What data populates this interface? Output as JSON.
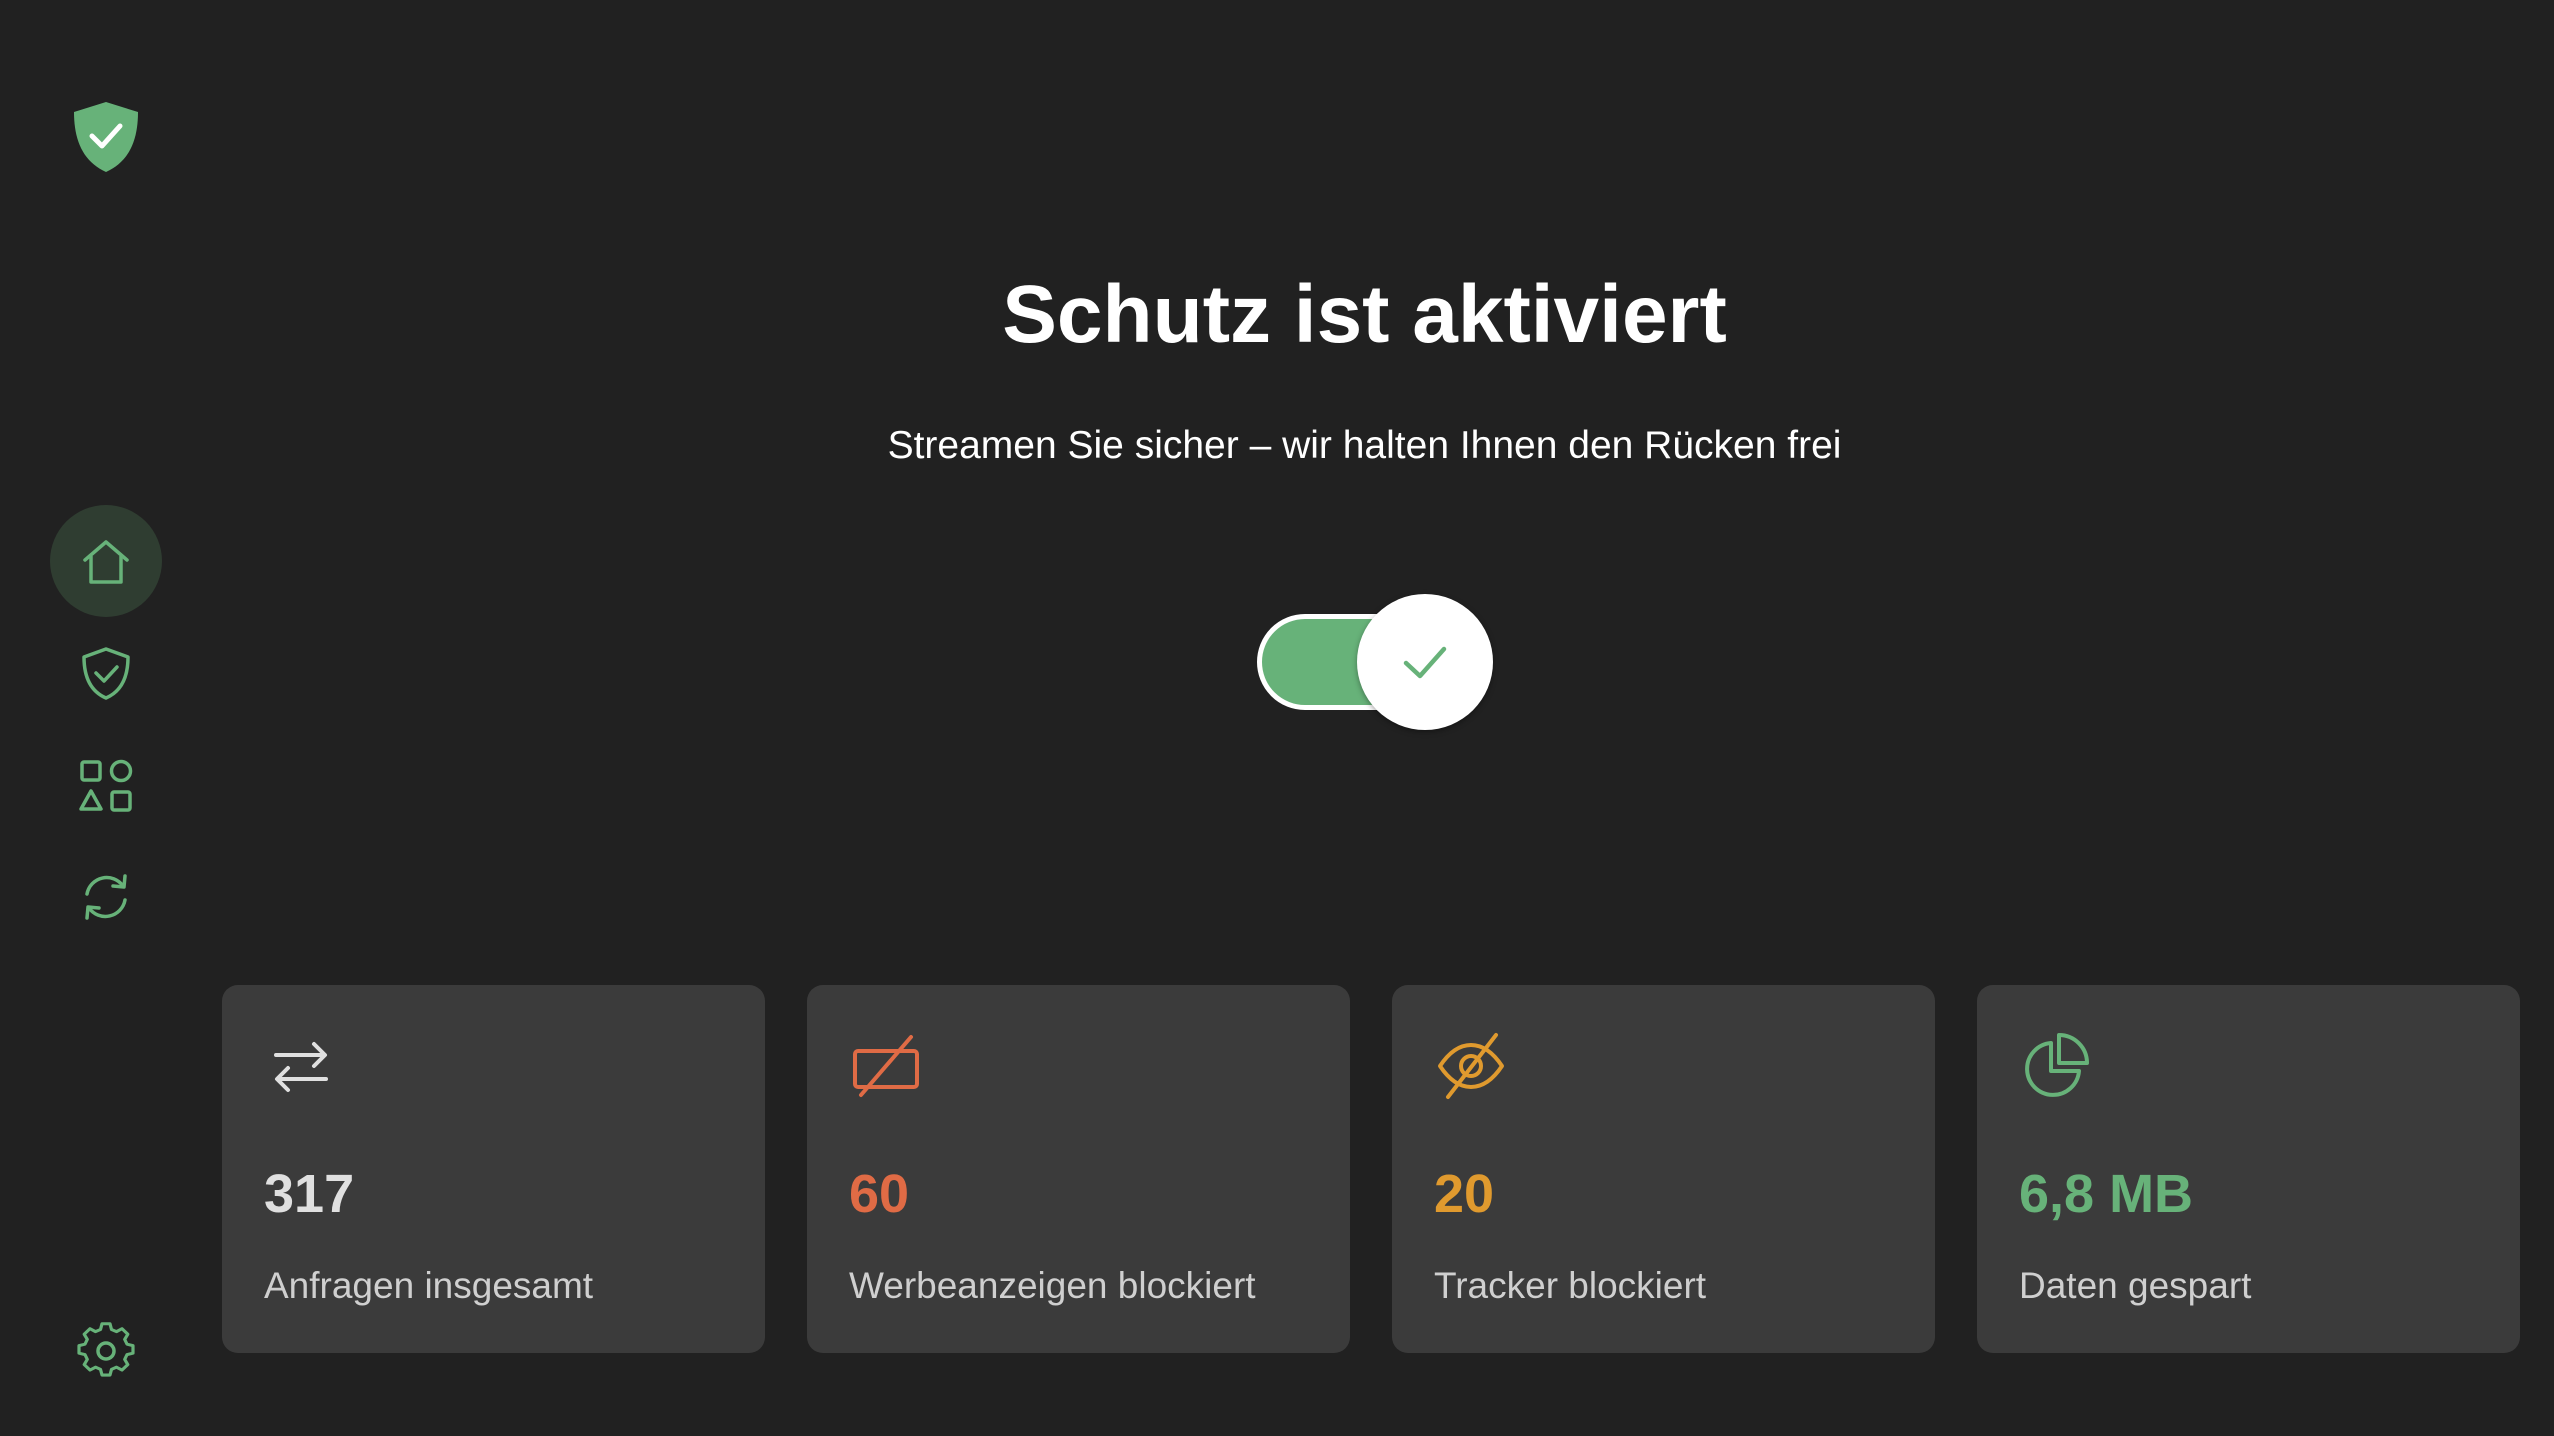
{
  "app": {
    "logo_icon": "shield-check-icon",
    "accent_color": "#67b279"
  },
  "sidebar": {
    "items": [
      {
        "id": "home",
        "icon": "home-icon",
        "active": true
      },
      {
        "id": "protection",
        "icon": "shield-check-icon",
        "active": false
      },
      {
        "id": "apps",
        "icon": "apps-grid-icon",
        "active": false
      },
      {
        "id": "update",
        "icon": "refresh-icon",
        "active": false
      }
    ],
    "settings_icon": "gear-icon"
  },
  "hero": {
    "title": "Schutz ist aktiviert",
    "subtitle": "Streamen Sie sicher – wir halten Ihnen den Rücken frei",
    "toggle_on": true
  },
  "stats": [
    {
      "icon": "arrows-exchange-icon",
      "value": "317",
      "label": "Anfragen insgesamt",
      "color": "#e0e0e0"
    },
    {
      "icon": "ad-blocked-icon",
      "value": "60",
      "label": "Werbeanzeigen blockiert",
      "color": "#e06b45"
    },
    {
      "icon": "eye-off-icon",
      "value": "20",
      "label": "Tracker blockiert",
      "color": "#e09a2e"
    },
    {
      "icon": "pie-chart-icon",
      "value": "6,8 MB",
      "label": "Daten gespart",
      "color": "#67b279"
    }
  ]
}
